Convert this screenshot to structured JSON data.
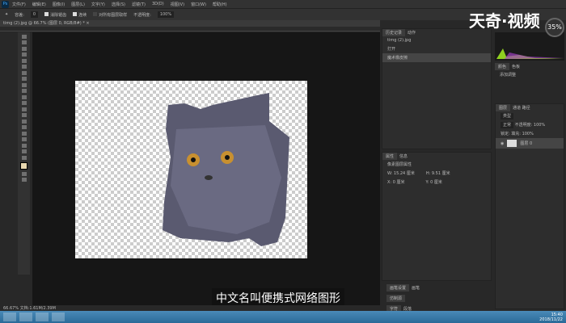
{
  "menu": [
    "文件(F)",
    "编辑(E)",
    "图像(I)",
    "图层(L)",
    "文字(Y)",
    "选择(S)",
    "滤镜(T)",
    "3D(D)",
    "视图(V)",
    "窗口(W)",
    "帮助(H)"
  ],
  "app_logo": "Ps",
  "options": {
    "tolerance_label": "容差:",
    "tolerance": "0",
    "antialias": "消除锯齿",
    "contiguous": "连续",
    "sample_all": "对所有图层取样",
    "opacity_label": "不透明度:",
    "opacity": "100%"
  },
  "doc_tab": "timg (2).jpg @ 66.7% (图层 0, RGB/8#) * ×",
  "status": "66.67%    文档:1.61M/2.39M",
  "subtitle": "中文名叫便携式网络图形",
  "watermark": "天奇·视频",
  "gauge": "35%",
  "history": {
    "tabs": [
      "历史记录",
      "动作"
    ],
    "items": [
      "timg (2).jpg",
      "打开",
      "魔术橡皮擦"
    ]
  },
  "properties": {
    "tabs": [
      "属性",
      "信息"
    ],
    "title": "像素图层属性",
    "w": "W: 15.24 厘米",
    "h": "H: 9.51 厘米",
    "x": "X: 0 厘米",
    "y": "Y: 0 厘米"
  },
  "bottom_tabs": [
    "画笔设置",
    "画笔",
    "仿制源",
    "字符",
    "段落"
  ],
  "adjust": {
    "tabs": [
      "颜色",
      "色板"
    ],
    "title": "添加调整"
  },
  "layers": {
    "tabs": [
      "图层",
      "通道",
      "路径"
    ],
    "kind": "类型",
    "mode": "正常",
    "opacity_label": "不透明度:",
    "opacity": "100%",
    "lock_label": "锁定:",
    "fill_label": "填充:",
    "fill": "100%",
    "layer_name": "图层 0"
  },
  "clock": {
    "time": "15:40",
    "date": "2018/11/22"
  }
}
